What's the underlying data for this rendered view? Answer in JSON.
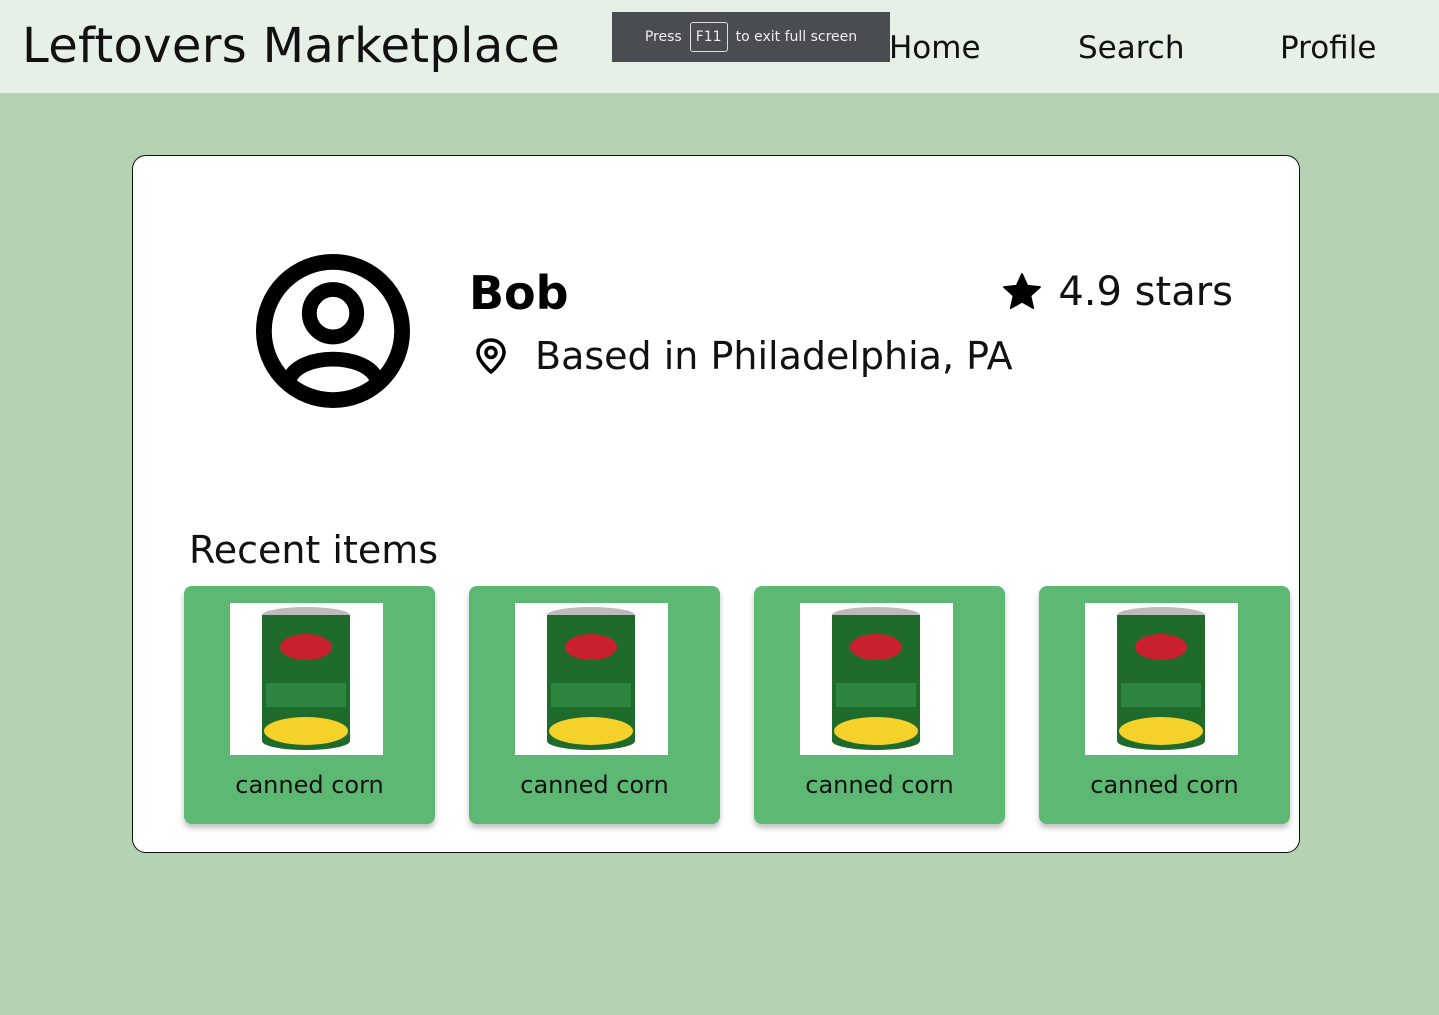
{
  "header": {
    "brand": "Leftovers Marketplace",
    "nav": {
      "home": "Home",
      "search": "Search",
      "profile": "Profile"
    }
  },
  "fullscreen_toast": {
    "prefix": "Press",
    "key": "F11",
    "suffix": "to exit full screen"
  },
  "profile": {
    "avatar_icon": "user-circle-icon",
    "name": "Bob",
    "location_icon": "map-pin-icon",
    "location": "Based in Philadelphia, PA",
    "rating_icon": "star-icon",
    "rating": "4.9 stars"
  },
  "recent": {
    "title": "Recent items",
    "items": [
      {
        "label": "canned corn",
        "image": "canned-corn-can"
      },
      {
        "label": "canned corn",
        "image": "canned-corn-can"
      },
      {
        "label": "canned corn",
        "image": "canned-corn-can"
      },
      {
        "label": "canned corn",
        "image": "canned-corn-can"
      }
    ]
  },
  "colors": {
    "page_bg": "#b5d2b2",
    "header_bg": "#e6f0e6",
    "item_bg": "#5cb873",
    "card_bg": "#ffffff"
  }
}
